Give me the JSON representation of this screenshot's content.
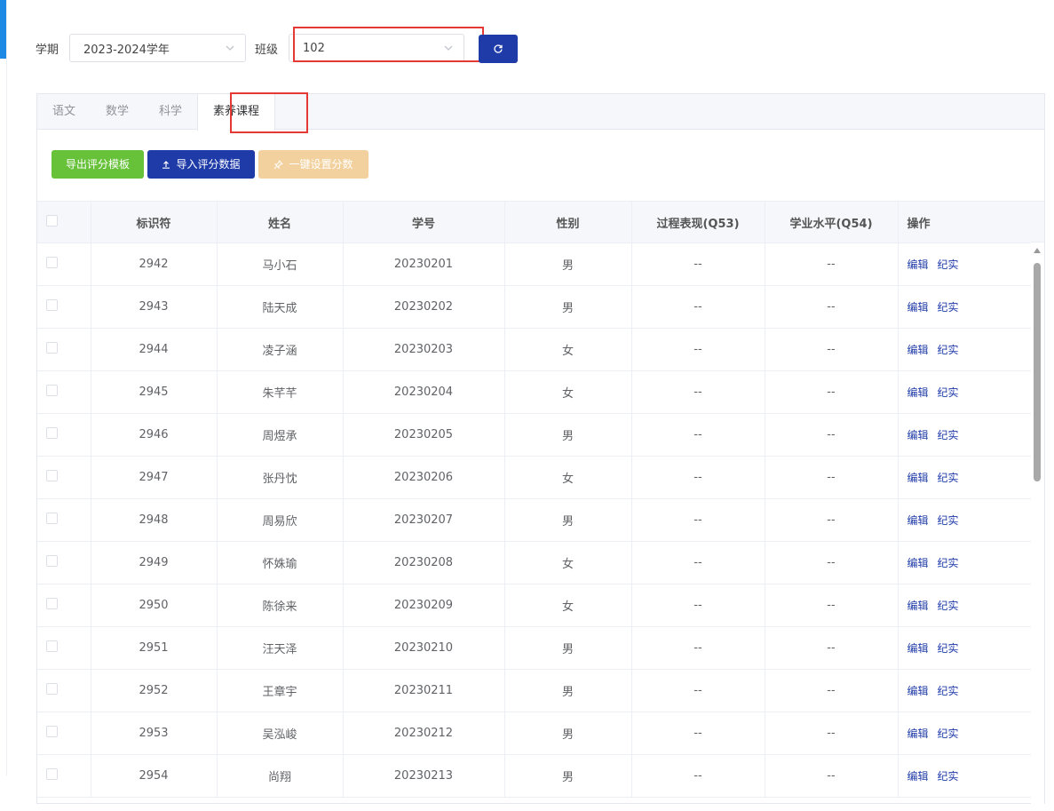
{
  "filters": {
    "term_label": "学期",
    "term_value": "2023-2024学年",
    "class_label": "班级",
    "class_value": "102"
  },
  "tabs": [
    {
      "label": "语文"
    },
    {
      "label": "数学"
    },
    {
      "label": "科学"
    },
    {
      "label": "素养课程"
    }
  ],
  "active_tab": "素养课程",
  "actions": {
    "export_label": "导出评分模板",
    "import_label": "导入评分数据",
    "set_score_label": "一键设置分数"
  },
  "table": {
    "headers": [
      "标识符",
      "姓名",
      "学号",
      "性别",
      "过程表现(Q53)",
      "学业水平(Q54)",
      "操作"
    ],
    "edit_label": "编辑",
    "record_label": "纪实",
    "rows": [
      {
        "id": "2942",
        "name": "马小石",
        "no": "20230201",
        "gender": "男",
        "q53": "--",
        "q54": "--"
      },
      {
        "id": "2943",
        "name": "陆天成",
        "no": "20230202",
        "gender": "男",
        "q53": "--",
        "q54": "--"
      },
      {
        "id": "2944",
        "name": "凌子涵",
        "no": "20230203",
        "gender": "女",
        "q53": "--",
        "q54": "--"
      },
      {
        "id": "2945",
        "name": "朱芊芊",
        "no": "20230204",
        "gender": "女",
        "q53": "--",
        "q54": "--"
      },
      {
        "id": "2946",
        "name": "周煜承",
        "no": "20230205",
        "gender": "男",
        "q53": "--",
        "q54": "--"
      },
      {
        "id": "2947",
        "name": "张丹忱",
        "no": "20230206",
        "gender": "女",
        "q53": "--",
        "q54": "--"
      },
      {
        "id": "2948",
        "name": "周易欣",
        "no": "20230207",
        "gender": "男",
        "q53": "--",
        "q54": "--"
      },
      {
        "id": "2949",
        "name": "怀姝瑜",
        "no": "20230208",
        "gender": "女",
        "q53": "--",
        "q54": "--"
      },
      {
        "id": "2950",
        "name": "陈徐来",
        "no": "20230209",
        "gender": "女",
        "q53": "--",
        "q54": "--"
      },
      {
        "id": "2951",
        "name": "汪天泽",
        "no": "20230210",
        "gender": "男",
        "q53": "--",
        "q54": "--"
      },
      {
        "id": "2952",
        "name": "王章宇",
        "no": "20230211",
        "gender": "男",
        "q53": "--",
        "q54": "--"
      },
      {
        "id": "2953",
        "name": "吴泓峻",
        "no": "20230212",
        "gender": "男",
        "q53": "--",
        "q54": "--"
      },
      {
        "id": "2954",
        "name": "尚翔",
        "no": "20230213",
        "gender": "男",
        "q53": "--",
        "q54": "--"
      }
    ]
  },
  "colors": {
    "primary": "#1f3ba8",
    "success": "#67c23a",
    "disabled_warning": "#f3d19e",
    "highlight": "#e53935"
  }
}
